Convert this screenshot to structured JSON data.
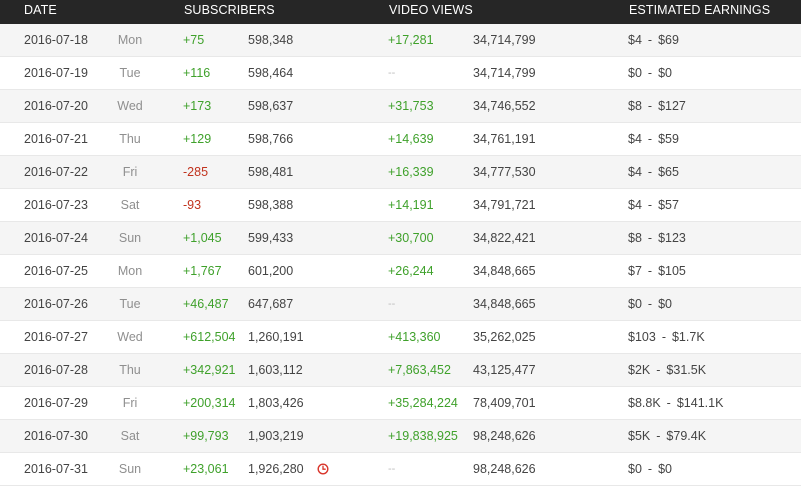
{
  "header": {
    "date": "DATE",
    "subscribers": "SUBSCRIBERS",
    "video_views": "VIDEO VIEWS",
    "estimated_earnings": "ESTIMATED EARNINGS"
  },
  "rows": [
    {
      "date": "2016-07-18",
      "day": "Mon",
      "sub_change": "+75",
      "sub_change_type": "pos",
      "sub_total": "598,348",
      "view_change": "+17,281",
      "view_change_type": "pos",
      "view_total": "34,714,799",
      "earn_low": "$4",
      "earn_sep": "-",
      "earn_high": "$69"
    },
    {
      "date": "2016-07-19",
      "day": "Tue",
      "sub_change": "+116",
      "sub_change_type": "pos",
      "sub_total": "598,464",
      "view_change": "--",
      "view_change_type": "none",
      "view_total": "34,714,799",
      "earn_low": "$0",
      "earn_sep": "-",
      "earn_high": "$0"
    },
    {
      "date": "2016-07-20",
      "day": "Wed",
      "sub_change": "+173",
      "sub_change_type": "pos",
      "sub_total": "598,637",
      "view_change": "+31,753",
      "view_change_type": "pos",
      "view_total": "34,746,552",
      "earn_low": "$8",
      "earn_sep": "-",
      "earn_high": "$127"
    },
    {
      "date": "2016-07-21",
      "day": "Thu",
      "sub_change": "+129",
      "sub_change_type": "pos",
      "sub_total": "598,766",
      "view_change": "+14,639",
      "view_change_type": "pos",
      "view_total": "34,761,191",
      "earn_low": "$4",
      "earn_sep": "-",
      "earn_high": "$59"
    },
    {
      "date": "2016-07-22",
      "day": "Fri",
      "sub_change": "-285",
      "sub_change_type": "neg",
      "sub_total": "598,481",
      "view_change": "+16,339",
      "view_change_type": "pos",
      "view_total": "34,777,530",
      "earn_low": "$4",
      "earn_sep": "-",
      "earn_high": "$65"
    },
    {
      "date": "2016-07-23",
      "day": "Sat",
      "sub_change": "-93",
      "sub_change_type": "neg",
      "sub_total": "598,388",
      "view_change": "+14,191",
      "view_change_type": "pos",
      "view_total": "34,791,721",
      "earn_low": "$4",
      "earn_sep": "-",
      "earn_high": "$57"
    },
    {
      "date": "2016-07-24",
      "day": "Sun",
      "sub_change": "+1,045",
      "sub_change_type": "pos",
      "sub_total": "599,433",
      "view_change": "+30,700",
      "view_change_type": "pos",
      "view_total": "34,822,421",
      "earn_low": "$8",
      "earn_sep": "-",
      "earn_high": "$123"
    },
    {
      "date": "2016-07-25",
      "day": "Mon",
      "sub_change": "+1,767",
      "sub_change_type": "pos",
      "sub_total": "601,200",
      "view_change": "+26,244",
      "view_change_type": "pos",
      "view_total": "34,848,665",
      "earn_low": "$7",
      "earn_sep": "-",
      "earn_high": "$105"
    },
    {
      "date": "2016-07-26",
      "day": "Tue",
      "sub_change": "+46,487",
      "sub_change_type": "pos",
      "sub_total": "647,687",
      "view_change": "--",
      "view_change_type": "none",
      "view_total": "34,848,665",
      "earn_low": "$0",
      "earn_sep": "-",
      "earn_high": "$0"
    },
    {
      "date": "2016-07-27",
      "day": "Wed",
      "sub_change": "+612,504",
      "sub_change_type": "pos",
      "sub_total": "1,260,191",
      "view_change": "+413,360",
      "view_change_type": "pos",
      "view_total": "35,262,025",
      "earn_low": "$103",
      "earn_sep": "-",
      "earn_high": "$1.7K"
    },
    {
      "date": "2016-07-28",
      "day": "Thu",
      "sub_change": "+342,921",
      "sub_change_type": "pos",
      "sub_total": "1,603,112",
      "view_change": "+7,863,452",
      "view_change_type": "pos",
      "view_total": "43,125,477",
      "earn_low": "$2K",
      "earn_sep": "-",
      "earn_high": "$31.5K"
    },
    {
      "date": "2016-07-29",
      "day": "Fri",
      "sub_change": "+200,314",
      "sub_change_type": "pos",
      "sub_total": "1,803,426",
      "view_change": "+35,284,224",
      "view_change_type": "pos",
      "view_total": "78,409,701",
      "earn_low": "$8.8K",
      "earn_sep": "-",
      "earn_high": "$141.1K"
    },
    {
      "date": "2016-07-30",
      "day": "Sat",
      "sub_change": "+99,793",
      "sub_change_type": "pos",
      "sub_total": "1,903,219",
      "view_change": "+19,838,925",
      "view_change_type": "pos",
      "view_total": "98,248,626",
      "earn_low": "$5K",
      "earn_sep": "-",
      "earn_high": "$79.4K"
    },
    {
      "date": "2016-07-31",
      "day": "Sun",
      "sub_change": "+23,061",
      "sub_change_type": "pos",
      "sub_total": "1,926,280",
      "view_change": "--",
      "view_change_type": "none",
      "view_total": "98,248,626",
      "earn_low": "$0",
      "earn_sep": "-",
      "earn_high": "$0",
      "icon": "clock-icon"
    }
  ],
  "colors": {
    "header_bg": "#262626",
    "positive": "#3fa12b",
    "negative": "#c1331e",
    "clock_icon": "#d9352b"
  }
}
